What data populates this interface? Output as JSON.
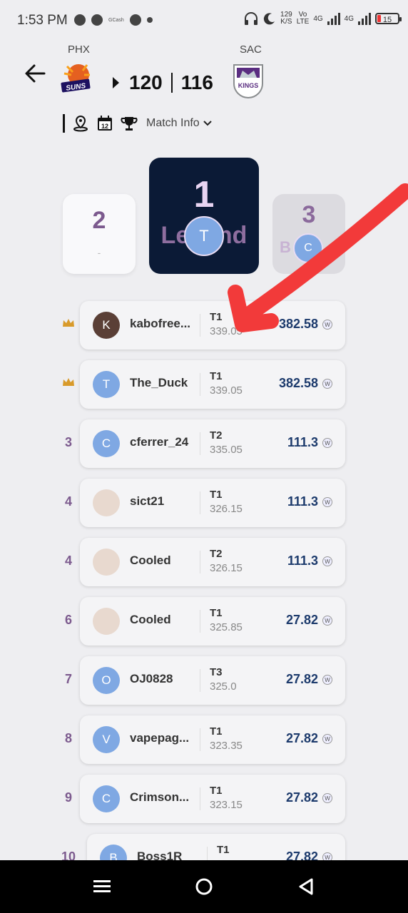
{
  "status_bar": {
    "time": "1:53 PM",
    "gcash": "GCash",
    "net_speed_value": "129",
    "net_speed_unit": "K/S",
    "volte_top": "Vo",
    "volte_bottom": "LTE",
    "net1": "4G",
    "net2": "4G",
    "battery": "15"
  },
  "header": {
    "home_abbr": "PHX",
    "away_abbr": "SAC",
    "home_score": "120",
    "away_score": "116",
    "home_logo_text": "SUNS",
    "away_logo_text": "KINGS",
    "calendar_day": "12",
    "match_info_label": "Match Info"
  },
  "podium": {
    "second": {
      "rank": "2",
      "placeholder": "-"
    },
    "first": {
      "rank": "1",
      "title": "Legend",
      "avatar": "T"
    },
    "third": {
      "rank": "3",
      "title": "B",
      "avatar": "C"
    }
  },
  "leaderboard": [
    {
      "rank": "",
      "crown": true,
      "avatar": "K",
      "name": "kabofree...",
      "team": "T1",
      "points": "339.05",
      "score": "382.58"
    },
    {
      "rank": "",
      "crown": true,
      "avatar": "T",
      "name": "The_Duck",
      "team": "T1",
      "points": "339.05",
      "score": "382.58"
    },
    {
      "rank": "3",
      "crown": false,
      "avatar": "C",
      "name": "cferrer_24",
      "team": "T2",
      "points": "335.05",
      "score": "111.3"
    },
    {
      "rank": "4",
      "crown": false,
      "avatar": "",
      "name": "sict21",
      "team": "T1",
      "points": "326.15",
      "score": "111.3"
    },
    {
      "rank": "4",
      "crown": false,
      "avatar": "",
      "name": "Cooled",
      "team": "T2",
      "points": "326.15",
      "score": "111.3"
    },
    {
      "rank": "6",
      "crown": false,
      "avatar": "",
      "name": "Cooled",
      "team": "T1",
      "points": "325.85",
      "score": "27.82"
    },
    {
      "rank": "7",
      "crown": false,
      "avatar": "O",
      "name": "OJ0828",
      "team": "T3",
      "points": "325.0",
      "score": "27.82"
    },
    {
      "rank": "8",
      "crown": false,
      "avatar": "V",
      "name": "vapepag...",
      "team": "T1",
      "points": "323.35",
      "score": "27.82"
    },
    {
      "rank": "9",
      "crown": false,
      "avatar": "C",
      "name": "Crimson...",
      "team": "T1",
      "points": "323.15",
      "score": "27.82"
    },
    {
      "rank": "10",
      "crown": false,
      "avatar": "B",
      "name": "Boss1R",
      "team": "T1",
      "points": "",
      "score": "27.82"
    }
  ],
  "coin_symbol": "W",
  "colors": {
    "accent_purple": "#7c5a8e",
    "score_blue": "#1c3a6c",
    "legend_bg": "#0b1a36",
    "avatar_blue": "#7fa8e3",
    "annotation_red": "#f23a3a"
  }
}
